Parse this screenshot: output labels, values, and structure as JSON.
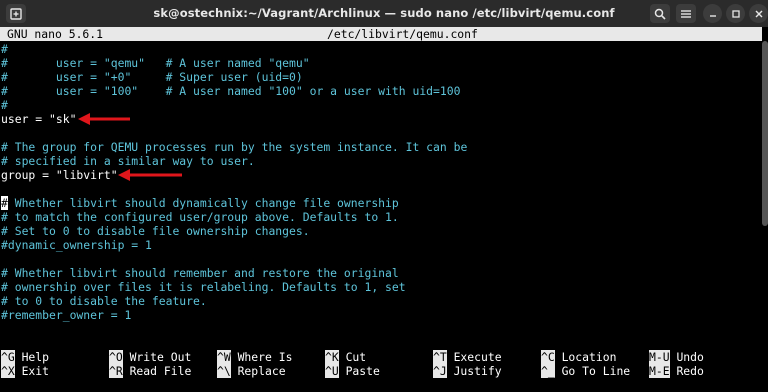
{
  "window": {
    "title": "sk@ostechnix:~/Vagrant/Archlinux — sudo nano /etc/libvirt/qemu.conf"
  },
  "nano": {
    "version": "GNU nano 5.6.1",
    "filename": "/etc/libvirt/qemu.conf"
  },
  "lines": [
    {
      "text": "#",
      "kind": "comment"
    },
    {
      "text": "#       user = \"qemu\"   # A user named \"qemu\"",
      "kind": "comment"
    },
    {
      "text": "#       user = \"+0\"     # Super user (uid=0)",
      "kind": "comment"
    },
    {
      "text": "#       user = \"100\"    # A user named \"100\" or a user with uid=100",
      "kind": "comment"
    },
    {
      "text": "#",
      "kind": "comment"
    },
    {
      "text": "user = \"sk\"",
      "kind": "code"
    },
    {
      "text": "",
      "kind": "code"
    },
    {
      "text": "# The group for QEMU processes run by the system instance. It can be",
      "kind": "comment"
    },
    {
      "text": "# specified in a similar way to user.",
      "kind": "comment"
    },
    {
      "text": "group = \"libvirt\"",
      "kind": "code"
    },
    {
      "text": "",
      "kind": "code"
    },
    {
      "text": "# Whether libvirt should dynamically change file ownership",
      "kind": "comment"
    },
    {
      "text": "# to match the configured user/group above. Defaults to 1.",
      "kind": "comment"
    },
    {
      "text": "# Set to 0 to disable file ownership changes.",
      "kind": "comment"
    },
    {
      "text": "#dynamic_ownership = 1",
      "kind": "comment"
    },
    {
      "text": "",
      "kind": "code"
    },
    {
      "text": "# Whether libvirt should remember and restore the original",
      "kind": "comment"
    },
    {
      "text": "# ownership over files it is relabeling. Defaults to 1, set",
      "kind": "comment"
    },
    {
      "text": "# to 0 to disable the feature.",
      "kind": "comment"
    },
    {
      "text": "#remember_owner = 1",
      "kind": "comment"
    }
  ],
  "shortcuts": [
    {
      "key": "^G",
      "label": "Help"
    },
    {
      "key": "^X",
      "label": "Exit"
    },
    {
      "key": "^O",
      "label": "Write Out"
    },
    {
      "key": "^R",
      "label": "Read File"
    },
    {
      "key": "^W",
      "label": "Where Is"
    },
    {
      "key": "^\\",
      "label": "Replace"
    },
    {
      "key": "^K",
      "label": "Cut"
    },
    {
      "key": "^U",
      "label": "Paste"
    },
    {
      "key": "^T",
      "label": "Execute"
    },
    {
      "key": "^J",
      "label": "Justify"
    },
    {
      "key": "^C",
      "label": "Location"
    },
    {
      "key": "^_",
      "label": "Go To Line"
    },
    {
      "key": "M-U",
      "label": "Undo"
    },
    {
      "key": "M-E",
      "label": "Redo"
    }
  ],
  "icons": {
    "new_tab": "new-tab-icon",
    "search": "search-icon",
    "menu": "hamburger-menu-icon",
    "minimize": "minimize-icon",
    "maximize": "maximize-icon",
    "close": "close-icon"
  },
  "colors": {
    "comment": "#5ec4da",
    "code": "#ffffff",
    "arrow": "#e0161b",
    "header_bg": "#e8e8e8"
  }
}
